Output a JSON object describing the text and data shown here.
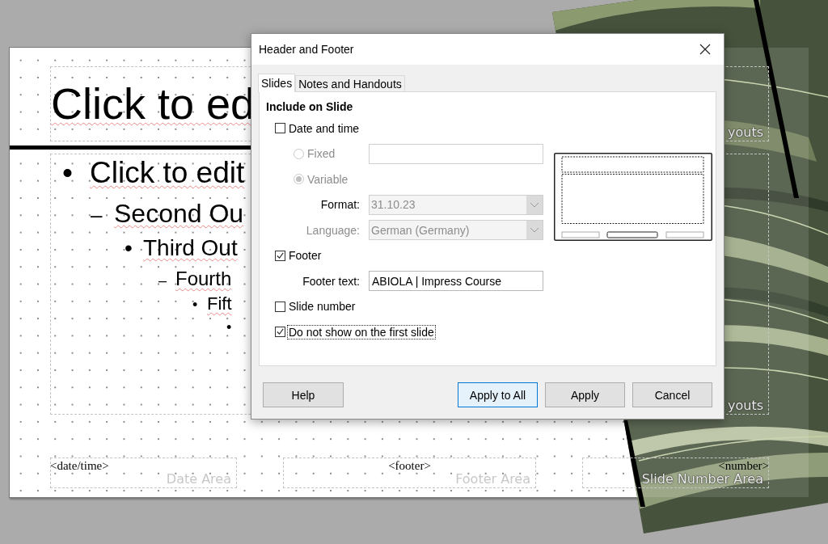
{
  "slide": {
    "title": "Click to ed",
    "outline": [
      {
        "bullet": "•",
        "text": "Click to edit",
        "children": [
          {
            "bullet": "–",
            "text": "Second Ou",
            "children": [
              {
                "bullet": "•",
                "text": "Third Out",
                "children": [
                  {
                    "bullet": "–",
                    "text": "Fourth",
                    "children": [
                      {
                        "bullet": "•",
                        "text": "Fift",
                        "children": [
                          {
                            "bullet": "•"
                          }
                        ]
                      }
                    ]
                  }
                ]
              }
            ]
          }
        ]
      }
    ],
    "layout_labels": [
      "youts",
      "youts"
    ],
    "footer_areas": [
      {
        "field": "<date/time>",
        "label": "Date Area"
      },
      {
        "field": "<footer>",
        "label": "Footer Area"
      },
      {
        "field": "<number>",
        "label": "Slide Number Area"
      }
    ]
  },
  "dialog": {
    "title": "Header and Footer",
    "tabs": [
      {
        "label": "Slides",
        "selected": true
      },
      {
        "label": "Notes and Handouts",
        "selected": false
      }
    ],
    "heading": "Include on Slide",
    "options": [
      {
        "kind": "checkbox",
        "label": "Date and time",
        "checked": false
      },
      {
        "kind": "radio-field",
        "label": "Fixed",
        "selected": false,
        "disabled": true
      },
      {
        "kind": "radio",
        "label": "Variable",
        "selected": true,
        "disabled": true
      },
      {
        "kind": "dropdown",
        "label": "Format:",
        "value": "31.10.23",
        "disabled": true,
        "label_disabled": false
      },
      {
        "kind": "dropdown",
        "label": "Language:",
        "value": "German (Germany)",
        "disabled": true,
        "label_disabled": true
      },
      {
        "kind": "checkbox",
        "label": "Footer",
        "checked": true
      },
      {
        "kind": "text-field",
        "label": "Footer text:",
        "value": "ABIOLA | Impress Course"
      },
      {
        "kind": "checkbox",
        "label": "Slide number",
        "checked": false
      },
      {
        "kind": "checkbox",
        "label": "Do not show on the first slide",
        "checked": true,
        "focused": true
      }
    ],
    "buttons": [
      {
        "label": "Help",
        "default": false
      },
      {
        "label": "Apply to All",
        "default": true
      },
      {
        "label": "Apply",
        "default": false
      },
      {
        "label": "Cancel",
        "default": false
      }
    ]
  }
}
